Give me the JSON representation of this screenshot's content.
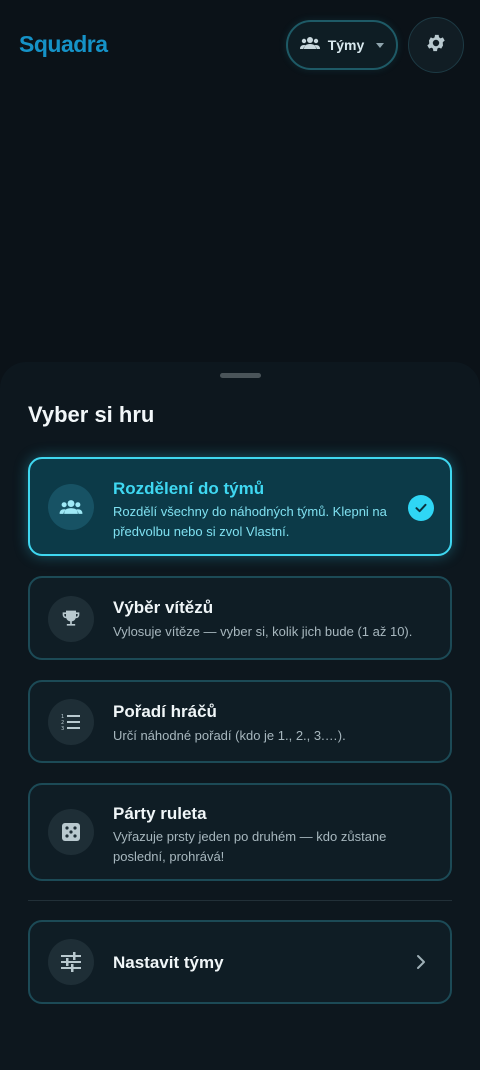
{
  "app": {
    "logo": "Squadra"
  },
  "header": {
    "mode_label": "Týmy",
    "mode_icon": "group-icon",
    "settings_icon": "gear-icon"
  },
  "sheet": {
    "title": "Vyber si hru",
    "games": [
      {
        "title": "Rozdělení do týmů",
        "desc": "Rozdělí všechny do náhodných týmů. Klepni na předvolbu nebo si zvol Vlastní.",
        "icon": "group-icon",
        "selected": true
      },
      {
        "title": "Výběr vítězů",
        "desc": "Vylosuje vítěze — vyber si, kolik jich bude (1 až 10).",
        "icon": "trophy-icon",
        "selected": false
      },
      {
        "title": "Pořadí hráčů",
        "desc": "Určí náhodné pořadí (kdo je 1., 2., 3.…).",
        "icon": "numbered-list-icon",
        "selected": false
      },
      {
        "title": "Párty ruleta",
        "desc": "Vyřazuje prsty jeden po druhém — kdo zůstane poslední, prohrává!",
        "icon": "dice-icon",
        "selected": false
      }
    ],
    "settings_row": {
      "title": "Nastavit týmy",
      "icon": "sliders-icon"
    }
  },
  "colors": {
    "accent": "#3fd7f0",
    "logo": "#1592c7",
    "background": "#0b1218"
  }
}
